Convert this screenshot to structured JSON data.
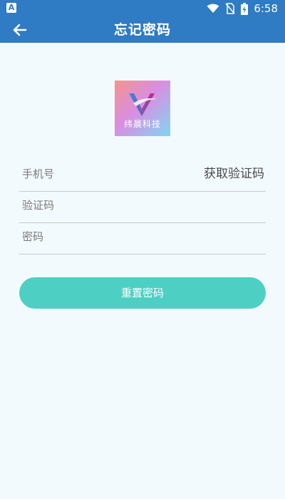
{
  "status_bar": {
    "time": "6:58",
    "left_icon": "A"
  },
  "app_bar": {
    "title": "忘记密码",
    "back_icon": "arrow-left-icon"
  },
  "logo": {
    "text": "纬晨科技"
  },
  "form": {
    "phone_placeholder": "手机号",
    "get_code_label": "获取验证码",
    "code_placeholder": "验证码",
    "password_placeholder": "密码",
    "submit_label": "重置密码"
  },
  "colors": {
    "primary": "#2f7bc4",
    "button": "#4ecfc4",
    "background": "#f3fafd"
  }
}
